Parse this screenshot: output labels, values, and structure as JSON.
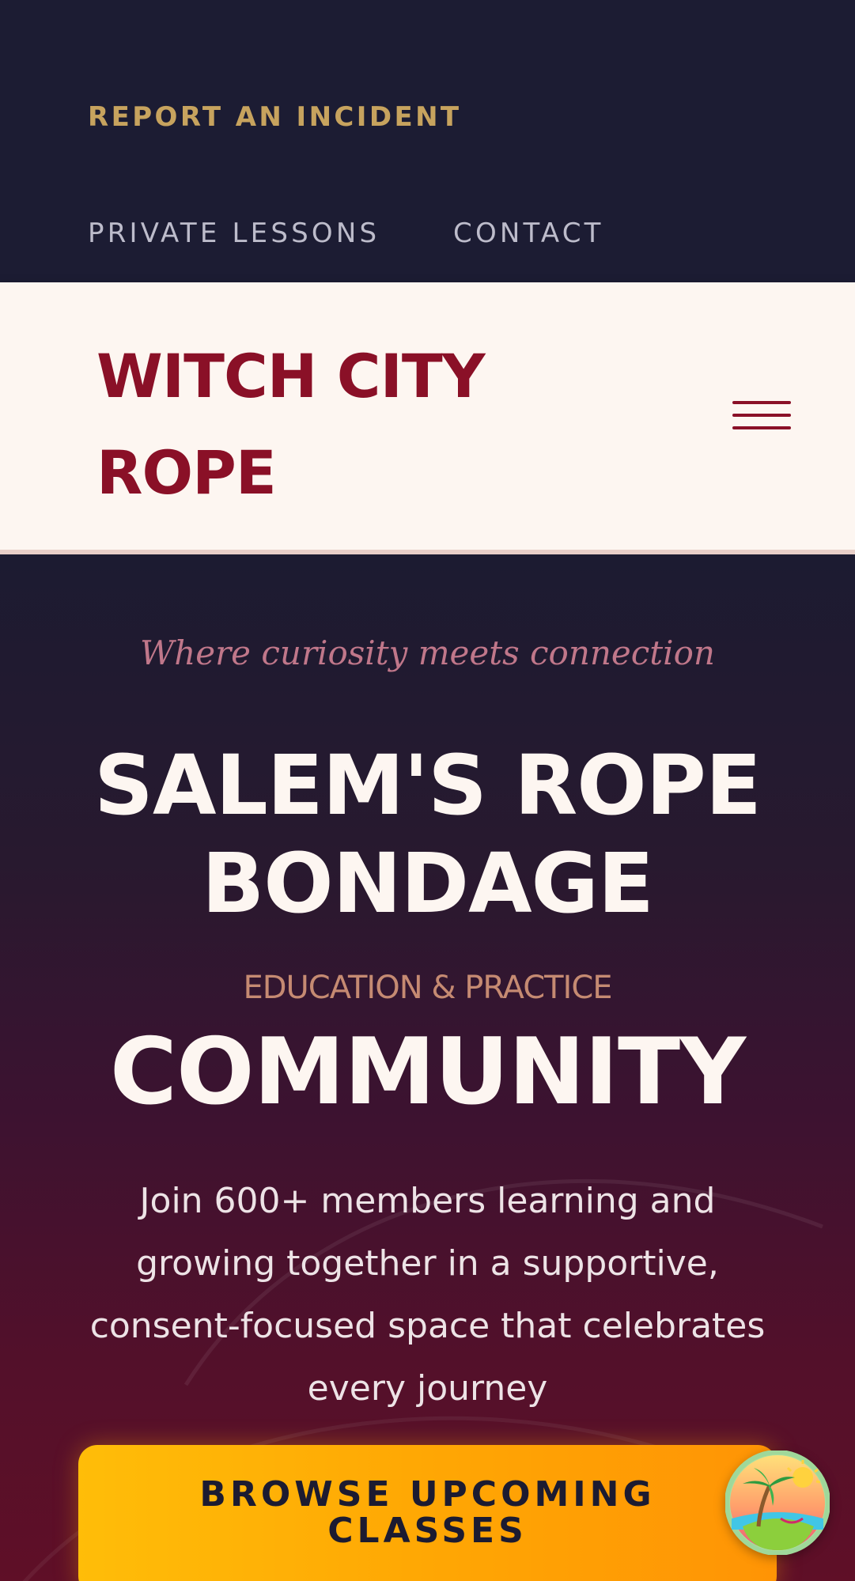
{
  "top_nav": {
    "report_label": "REPORT  AN INCIDENT",
    "links": [
      {
        "label": "PRIVATE LESSONS"
      },
      {
        "label": "CONTACT"
      }
    ]
  },
  "header": {
    "logo_line1": "WITCH CITY",
    "logo_line2": "ROPE",
    "menu_icon": "hamburger-menu-icon"
  },
  "hero": {
    "tagline": "Where curiosity meets connection",
    "headline_line1": "SALEM'S ROPE",
    "headline_line2": "BONDAGE",
    "eyebrow": "EDUCATION & PRACTICE",
    "community": "COMMUNITY",
    "description": "Join 600+ members learning and growing together in a supportive, consent-focused space that celebrates every journey",
    "cta_line1": "BROWSE UPCOMING",
    "cta_line2": "CLASSES"
  },
  "floating_badge": {
    "icon": "tropical-island-icon"
  },
  "colors": {
    "nav_background": "#1c1c33",
    "report_gold": "#c7a35e",
    "brand_crimson": "#8a1027",
    "header_cream": "#fdf6f1",
    "tagline_rose": "#c0778a",
    "eyebrow_copper": "#c58a72",
    "cta_gradient_start": "#ffbd08",
    "cta_gradient_end": "#ff9405"
  }
}
